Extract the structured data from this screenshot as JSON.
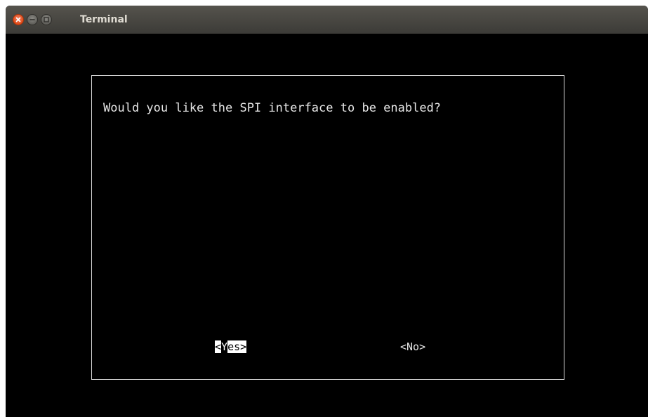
{
  "window": {
    "title": "Terminal"
  },
  "dialog": {
    "question": "Would you like the SPI interface to be enabled?",
    "yes_button": {
      "lt": "<",
      "cursor_char": "Y",
      "rest": "es>"
    },
    "no_button": "<No>"
  },
  "icons": {
    "close": "close-icon",
    "minimize": "minimize-icon",
    "maximize": "maximize-icon"
  },
  "colors": {
    "titlebar": "#3c3b37",
    "close_button": "#df4a16",
    "terminal_bg": "#000000",
    "terminal_text": "#e6e6e6",
    "dialog_border": "#d9d9d9"
  }
}
